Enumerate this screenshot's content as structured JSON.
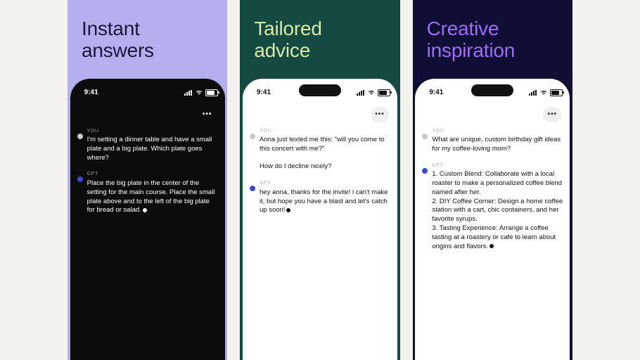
{
  "status_time": "9:41",
  "more_label": "•••",
  "role_user": "YOU",
  "role_gpt": "GPT",
  "panels": [
    {
      "title": "Instant\nanswers",
      "user_msg": "I'm setting a dinner table and have a small plate and a big plate. Which plate goes where?",
      "gpt_msg": "Place the big plate in the center of the setting for the main course. Place the small plate above and to the left of the big plate for bread or salad."
    },
    {
      "title": "Tailored\nadvice",
      "user_msg": "Anna just texted me this: \"will you come to this concert with me?\"\n\nHow do I decline nicely?",
      "gpt_msg": "hey anna, thanks for the invite! i can't make it, but hope you have a blast and let's catch up soon!"
    },
    {
      "title": "Creative\ninspiration",
      "user_msg": "What are unique, custom birthday gift ideas for my coffee-loving mom?",
      "gpt_msg": "1. Custom Blend: Collaborate with a local roaster to make a personalized coffee blend named after her.\n2. DIY Coffee Corner: Design a home coffee station with a cart, chic containers, and her favorite syrups.\n3. Tasting Experience: Arrange a coffee tasting at a roastery or cafe to learn about origins and flavors."
    }
  ]
}
